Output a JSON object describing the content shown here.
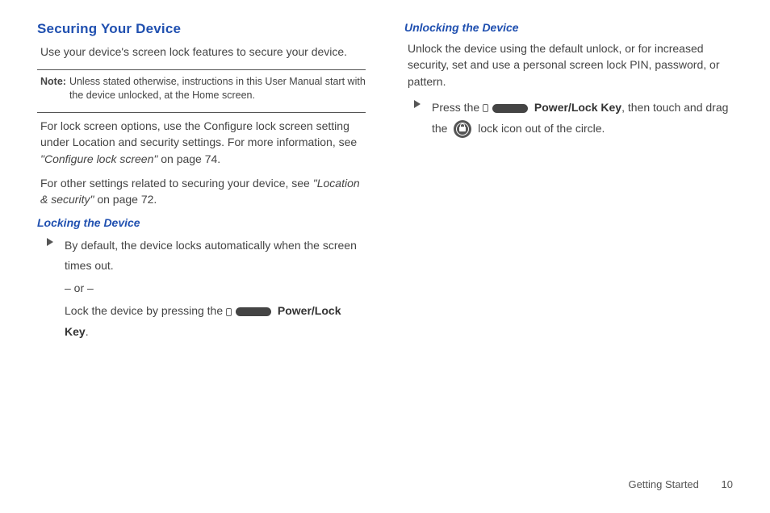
{
  "left": {
    "heading": "Securing Your Device",
    "intro": "Use your device's screen lock features to secure your device.",
    "note_label": "Note:",
    "note_text": "Unless stated otherwise, instructions in this User Manual start with the device unlocked, at the Home screen.",
    "para1_a": "For lock screen options, use the Configure lock screen setting under Location and security settings. For more information, see ",
    "para1_ref": "\"Configure lock screen\"",
    "para1_b": " on page 74.",
    "para2_a": "For other settings related to securing your device, see ",
    "para2_ref": "\"Location & security\"",
    "para2_b": " on page 72.",
    "sub_heading": "Locking the Device",
    "step1": "By default, the device locks automatically when the screen times out.",
    "or": "– or –",
    "step2_a": "Lock the device by pressing the ",
    "power_key": "Power/Lock Key",
    "step2_b": "."
  },
  "right": {
    "sub_heading": "Unlocking the Device",
    "intro": "Unlock the device using the default unlock, or for increased security, set and use a personal screen lock PIN, password, or pattern.",
    "step_a": "Press the ",
    "power_key": "Power/Lock Key",
    "step_b": ", then touch and drag the ",
    "step_c": " lock icon out of the circle."
  },
  "footer": {
    "section": "Getting Started",
    "page": "10"
  }
}
